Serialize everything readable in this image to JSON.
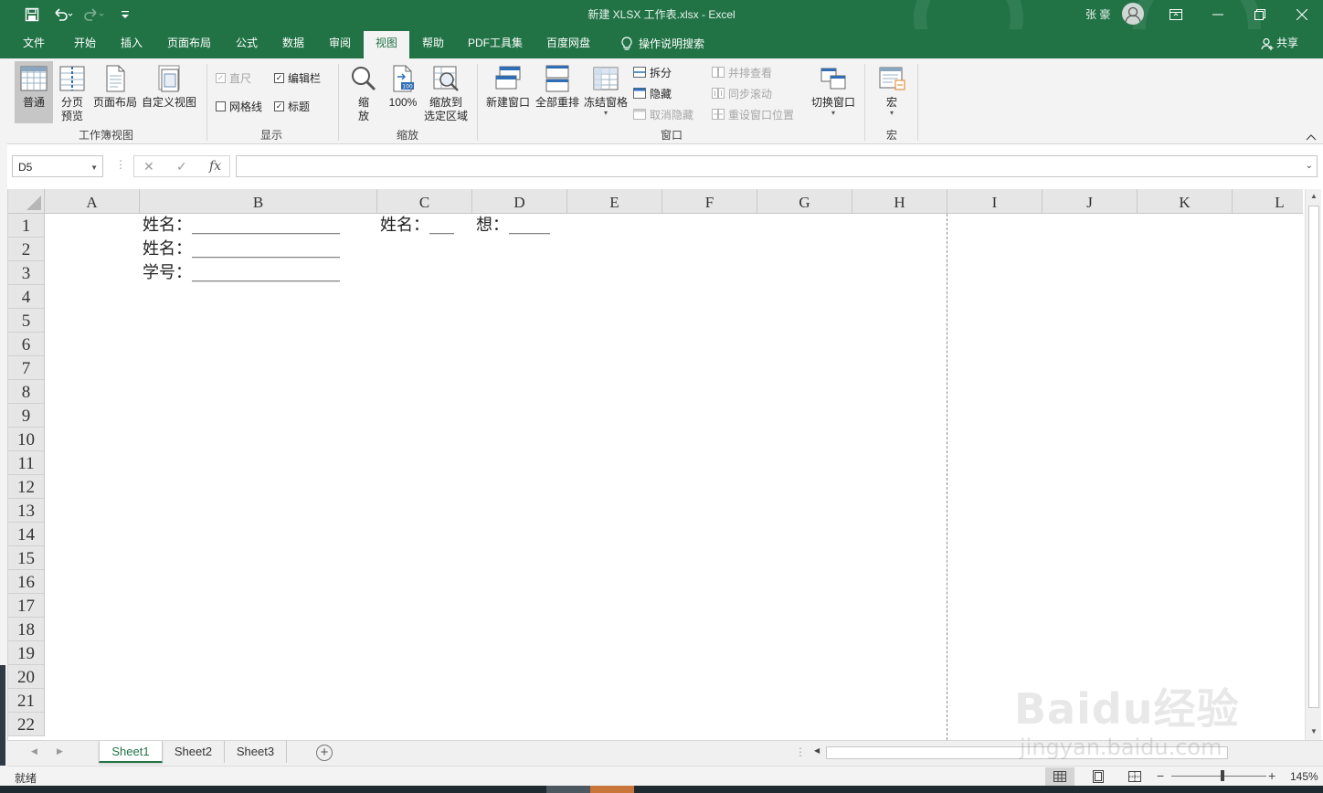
{
  "window": {
    "title": "新建 XLSX 工作表.xlsx  -  Excel",
    "user": "张 豪"
  },
  "ribbon_tabs": [
    "文件",
    "开始",
    "插入",
    "页面布局",
    "公式",
    "数据",
    "审阅",
    "视图",
    "帮助",
    "PDF工具集",
    "百度网盘",
    "操作说明搜索"
  ],
  "active_tab": "视图",
  "share_label": "共享",
  "ribbon": {
    "workbook_views": {
      "label": "工作簿视图",
      "normal": "普通",
      "page_break_1": "分页",
      "page_break_2": "预览",
      "page_layout": "页面布局",
      "custom_views": "自定义视图"
    },
    "show": {
      "label": "显示",
      "ruler": "直尺",
      "formula_bar": "编辑栏",
      "gridlines": "网格线",
      "headings": "标题",
      "ruler_checked": true,
      "formula_bar_checked": true,
      "gridlines_checked": false,
      "headings_checked": true
    },
    "zoom": {
      "label": "缩放",
      "zoom_1": "缩",
      "zoom_2": "放",
      "hundred": "100%",
      "to_selection_1": "缩放到",
      "to_selection_2": "选定区域"
    },
    "window": {
      "label": "窗口",
      "new_window": "新建窗口",
      "arrange_all": "全部重排",
      "freeze_panes": "冻结窗格",
      "split": "拆分",
      "hide": "隐藏",
      "unhide": "取消隐藏",
      "side_by_side": "并排查看",
      "sync_scroll": "同步滚动",
      "reset_position": "重设窗口位置",
      "switch_windows": "切换窗口"
    },
    "macros": {
      "label": "宏",
      "macros": "宏"
    }
  },
  "formula_bar": {
    "name_box": "D5",
    "formula": ""
  },
  "columns": [
    "A",
    "B",
    "C",
    "D",
    "E",
    "F",
    "G",
    "H",
    "I",
    "J",
    "K",
    "L"
  ],
  "rows": [
    "1",
    "2",
    "3",
    "4",
    "5",
    "6",
    "7",
    "8",
    "9",
    "10",
    "11",
    "12",
    "13",
    "14",
    "15",
    "16",
    "17",
    "18",
    "19",
    "20",
    "21",
    "22"
  ],
  "cells": {
    "b1": "姓名：__________________",
    "c1": "姓名：___",
    "d1": "想：_____",
    "b2": "姓名：__________________",
    "b3": "学号：__________________"
  },
  "sheets": [
    "Sheet1",
    "Sheet2",
    "Sheet3"
  ],
  "active_sheet": "Sheet1",
  "status": {
    "ready": "就绪",
    "zoom": "145%"
  },
  "watermark": {
    "main": "Baidu经验",
    "url": "jingyan.baidu.com"
  },
  "colors": {
    "brand_green": "#217346",
    "ribbon_bg": "#f3f3f3",
    "header_bg": "#e6e6e6"
  }
}
